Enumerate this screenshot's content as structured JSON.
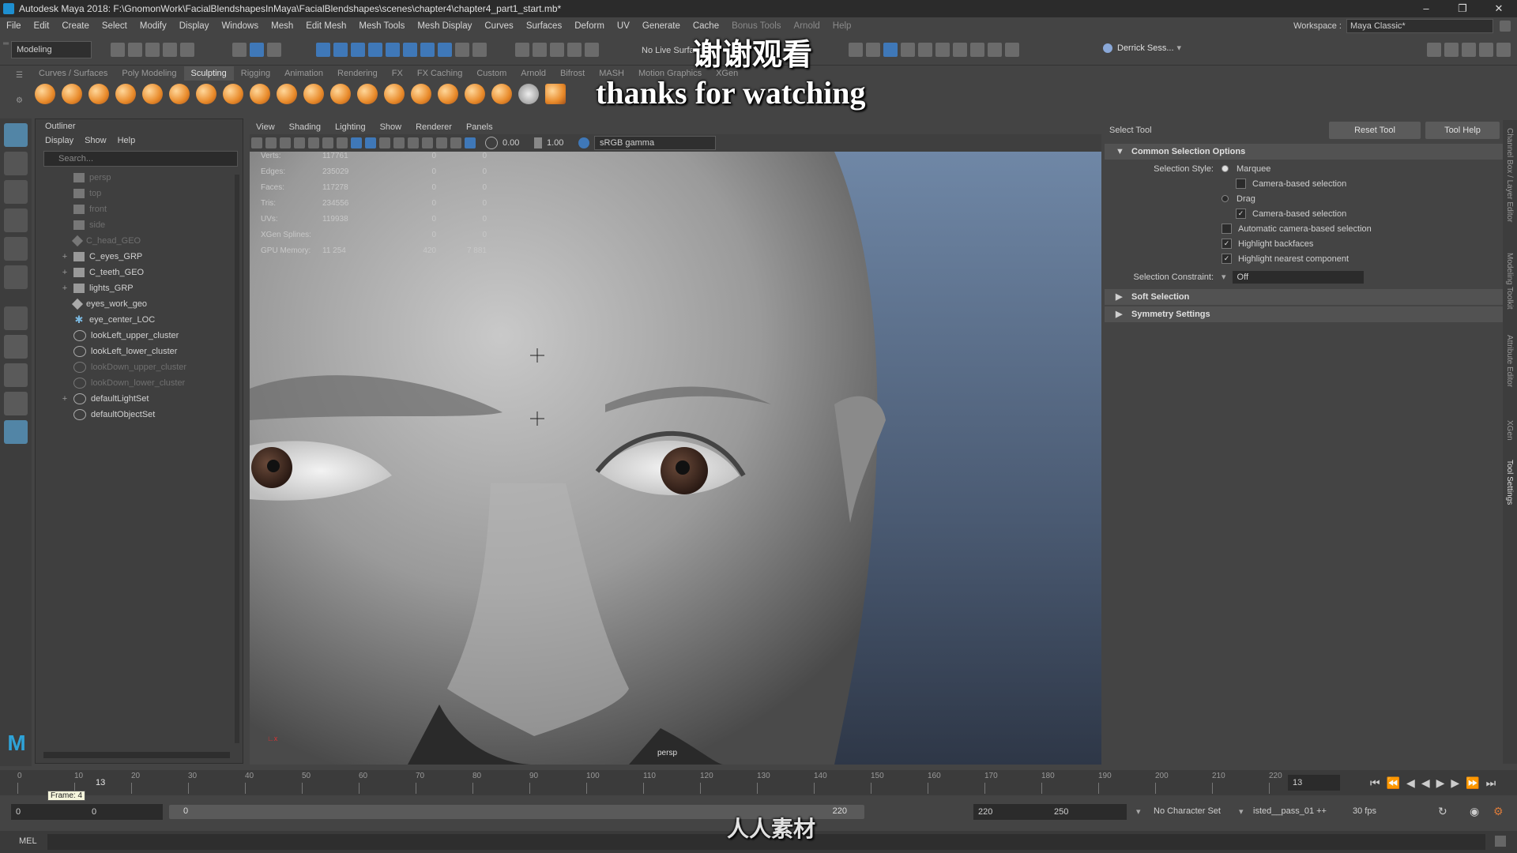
{
  "titlebar": {
    "title": "Autodesk Maya 2018: F:\\GnomonWork\\FacialBlendshapesInMaya\\FacialBlendshapes\\scenes\\chapter4\\chapter4_part1_start.mb*"
  },
  "menubar": {
    "items": [
      "File",
      "Edit",
      "Create",
      "Select",
      "Modify",
      "Display",
      "Windows",
      "Mesh",
      "Edit Mesh",
      "Mesh Tools",
      "Mesh Display",
      "Curves",
      "Surfaces",
      "Deform",
      "UV",
      "Generate",
      "Cache",
      "Bonus Tools",
      "Arnold",
      "Help"
    ],
    "workspace_label": "Workspace :",
    "workspace_value": "Maya Classic*"
  },
  "statusline": {
    "mode": "Modeling",
    "live_surface": "No Live Surface",
    "user": "Derrick Sess..."
  },
  "shelf": {
    "tabs": [
      "Curves / Surfaces",
      "Poly Modeling",
      "Sculpting",
      "Rigging",
      "Animation",
      "Rendering",
      "FX",
      "FX Caching",
      "Custom",
      "Arnold",
      "Bifrost",
      "MASH",
      "Motion Graphics",
      "XGen"
    ],
    "active_tab": "Sculpting"
  },
  "subtitles": {
    "cn": "谢谢观看",
    "en": "thanks for watching"
  },
  "outliner": {
    "title": "Outliner",
    "menu": [
      "Display",
      "Show",
      "Help"
    ],
    "search_placeholder": "Search...",
    "items": [
      {
        "label": "persp",
        "dim": true,
        "expand": ""
      },
      {
        "label": "top",
        "dim": true,
        "expand": ""
      },
      {
        "label": "front",
        "dim": true,
        "expand": ""
      },
      {
        "label": "side",
        "dim": true,
        "expand": ""
      },
      {
        "label": "C_head_GEO",
        "dim": true,
        "expand": ""
      },
      {
        "label": "C_eyes_GRP",
        "dim": false,
        "expand": "+"
      },
      {
        "label": "C_teeth_GEO",
        "dim": false,
        "expand": "+"
      },
      {
        "label": "lights_GRP",
        "dim": false,
        "expand": "+"
      },
      {
        "label": "eyes_work_geo",
        "dim": false,
        "expand": ""
      },
      {
        "label": "eye_center_LOC",
        "dim": false,
        "expand": ""
      },
      {
        "label": "lookLeft_upper_cluster",
        "dim": false,
        "expand": ""
      },
      {
        "label": "lookLeft_lower_cluster",
        "dim": false,
        "expand": ""
      },
      {
        "label": "lookDown_upper_cluster",
        "dim": true,
        "expand": ""
      },
      {
        "label": "lookDown_lower_cluster",
        "dim": true,
        "expand": ""
      },
      {
        "label": "defaultLightSet",
        "dim": false,
        "expand": "+"
      },
      {
        "label": "defaultObjectSet",
        "dim": false,
        "expand": ""
      }
    ]
  },
  "viewport": {
    "menu": [
      "View",
      "Shading",
      "Lighting",
      "Show",
      "Renderer",
      "Panels"
    ],
    "val1": "0.00",
    "val2": "1.00",
    "color_space": "sRGB gamma",
    "camera": "persp",
    "hud": [
      {
        "k": "Verts:",
        "v": "117761",
        "a": "0",
        "b": "0"
      },
      {
        "k": "Edges:",
        "v": "235029",
        "a": "0",
        "b": "0"
      },
      {
        "k": "Faces:",
        "v": "117278",
        "a": "0",
        "b": "0"
      },
      {
        "k": "Tris:",
        "v": "234556",
        "a": "0",
        "b": "0"
      },
      {
        "k": "UVs:",
        "v": "119938",
        "a": "0",
        "b": "0"
      },
      {
        "k": "XGen Splines:",
        "v": "",
        "a": "0",
        "b": "0"
      },
      {
        "k": "GPU Memory:",
        "v": "11 254",
        "a": "420",
        "b": "7 881"
      }
    ]
  },
  "toolsettings": {
    "title": "Select Tool",
    "reset": "Reset Tool",
    "help": "Tool Help",
    "section_common": "Common Selection Options",
    "selection_style_label": "Selection Style:",
    "marquee": "Marquee",
    "camera_based": "Camera-based selection",
    "drag": "Drag",
    "camera_based2": "Camera-based selection",
    "auto_camera": "Automatic camera-based selection",
    "highlight_backfaces": "Highlight backfaces",
    "highlight_nearest": "Highlight nearest component",
    "constraint_label": "Selection Constraint:",
    "constraint_value": "Off",
    "soft_selection": "Soft Selection",
    "symmetry": "Symmetry Settings"
  },
  "side_tabs": [
    "Channel Box / Layer Editor",
    "Modeling Toolkit",
    "Attribute Editor",
    "XGen",
    "Tool Settings"
  ],
  "timeline": {
    "ticks": [
      "0",
      "10",
      "20",
      "30",
      "40",
      "50",
      "60",
      "70",
      "80",
      "90",
      "100",
      "110",
      "120",
      "130",
      "140",
      "150",
      "160",
      "170",
      "180",
      "190",
      "200",
      "210",
      "220"
    ],
    "current_frame": "13",
    "current_frame_box": "13",
    "frame_tooltip": "Frame: 4"
  },
  "range": {
    "start": "0",
    "start2": "0",
    "slider_start": "0",
    "slider_end": "220",
    "end": "220",
    "end2": "250",
    "character_set": "No Character Set",
    "anim_layer": "isted__pass_01 ++",
    "fps": "30 fps"
  },
  "cmdline": {
    "label": "MEL"
  },
  "watermark": {
    "site": "人人素材"
  }
}
